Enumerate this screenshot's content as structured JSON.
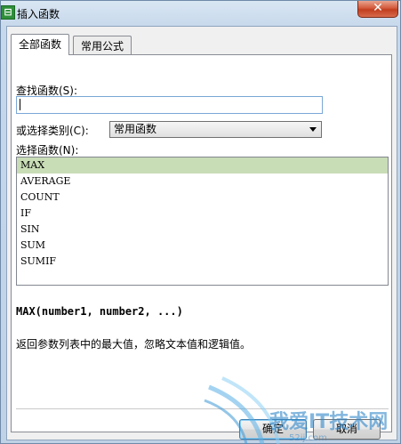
{
  "window": {
    "title": "插入函数",
    "close_glyph": "✕"
  },
  "tabs": [
    {
      "label": "全部函数",
      "active": true
    },
    {
      "label": "常用公式",
      "active": false
    }
  ],
  "search": {
    "label": "查找函数(S):",
    "value": "",
    "placeholder": ""
  },
  "category": {
    "label": "或选择类别(C):",
    "selected": "常用函数"
  },
  "function_list": {
    "label": "选择函数(N):",
    "items": [
      "MAX",
      "AVERAGE",
      "COUNT",
      "IF",
      "SIN",
      "SUM",
      "SUMIF"
    ],
    "selected_index": 0
  },
  "signature": "MAX(number1, number2, ...)",
  "description": "返回参数列表中的最大值，忽略文本值和逻辑值。",
  "buttons": {
    "ok": "确定",
    "cancel": "取消"
  },
  "watermark": {
    "text": "我爱IT技术网",
    "sub": "52ij.com"
  }
}
